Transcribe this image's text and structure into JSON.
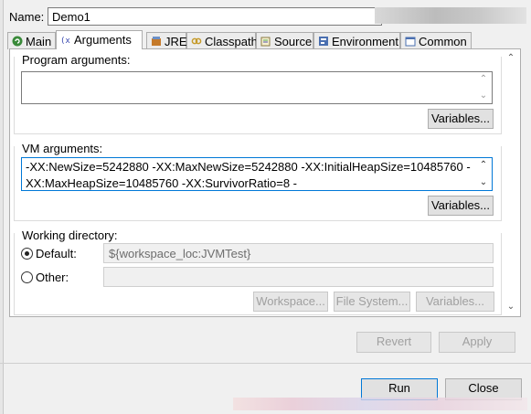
{
  "name": {
    "label": "Name:",
    "value": "Demo1"
  },
  "tabs": [
    {
      "label": "Main",
      "icon": "main-tab-icon"
    },
    {
      "label": "Arguments",
      "icon": "arguments-tab-icon"
    },
    {
      "label": "JRE",
      "icon": "jre-tab-icon"
    },
    {
      "label": "Classpath",
      "icon": "classpath-tab-icon"
    },
    {
      "label": "Source",
      "icon": "source-tab-icon"
    },
    {
      "label": "Environment",
      "icon": "environment-tab-icon"
    },
    {
      "label": "Common",
      "icon": "common-tab-icon"
    }
  ],
  "active_tab": "Arguments",
  "program_args": {
    "title": "Program arguments:",
    "value": "",
    "variables_label": "Variables..."
  },
  "vm_args": {
    "title": "VM arguments:",
    "line1": "-XX:NewSize=5242880 -XX:MaxNewSize=5242880 -XX:InitialHeapSize=10485760 -",
    "line2": "XX:MaxHeapSize=10485760 -XX:SurvivorRatio=8 -",
    "variables_label": "Variables..."
  },
  "working_dir": {
    "title": "Working directory:",
    "default_label": "Default:",
    "default_value": "${workspace_loc:JVMTest}",
    "other_label": "Other:",
    "other_value": "",
    "selected": "default",
    "workspace_btn": "Workspace...",
    "filesystem_btn": "File System...",
    "variables_btn": "Variables..."
  },
  "actions": {
    "revert": "Revert",
    "apply": "Apply"
  },
  "dialog": {
    "run": "Run",
    "close": "Close"
  }
}
